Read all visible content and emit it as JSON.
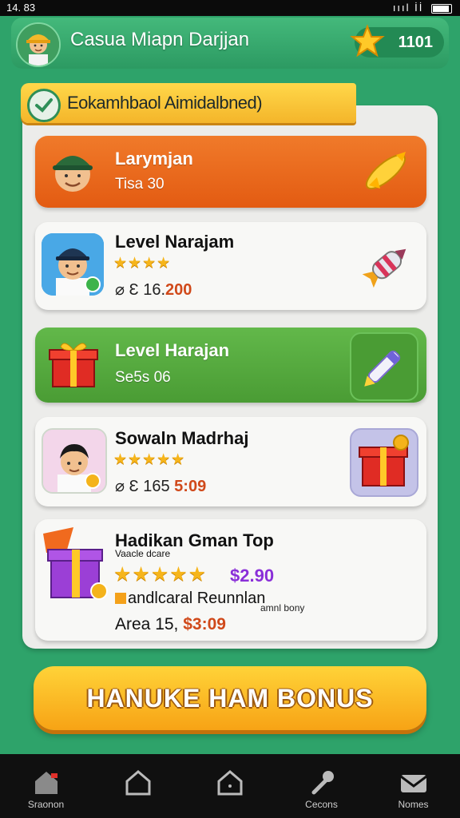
{
  "status_bar": {
    "time": "14. 83",
    "signal": "ıııl İİ"
  },
  "header": {
    "title": "Casua Miapn Darjjan",
    "coins": "1101"
  },
  "ribbon": {
    "text": "Eokamhbaol Aimidalbned)"
  },
  "cards": [
    {
      "name": "Larymjan",
      "sub": "Tisa 30"
    },
    {
      "name": "Level Narajam",
      "stars": "★★★★",
      "meta_prefix": "⌀ Ɛ 16.",
      "meta_value": "200"
    },
    {
      "name": "Level Harajan",
      "sub": "Se5s 06"
    },
    {
      "name": "Sowaln Madrhaj",
      "stars": "★★★★★",
      "meta_prefix": "⌀ Ɛ 165",
      "meta_value": "5:09"
    },
    {
      "name": "Hadikan Gman Top",
      "tag": "Vaacle dcare",
      "stars": "★★★★★",
      "price": "$2.90",
      "line3": "andlcaral Reunnlan",
      "note": "amnl bony",
      "line4_prefix": "Area 15,",
      "line4_value": "$3:09"
    }
  ],
  "bonus_button": "HANUKE HAM BONUS",
  "nav": [
    {
      "label": "Sraonon",
      "icon": "shop-icon"
    },
    {
      "label": "",
      "icon": "home-icon"
    },
    {
      "label": "",
      "icon": "house-icon"
    },
    {
      "label": "Cecons",
      "icon": "tools-icon"
    },
    {
      "label": "Nomes",
      "icon": "mail-icon"
    }
  ],
  "colors": {
    "bg": "#2ea36a",
    "orange_card": "#e35b12",
    "green_card": "#4a9c34",
    "button": "#f7a315",
    "accent_red": "#d0491a"
  }
}
